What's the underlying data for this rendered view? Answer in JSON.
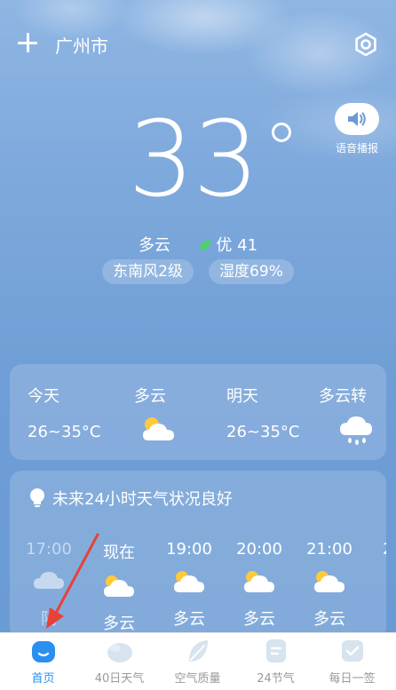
{
  "header": {
    "city": "广州市"
  },
  "voice": {
    "label": "语音播报"
  },
  "current": {
    "temperature": "33",
    "condition": "多云",
    "aqi": "优 41",
    "wind": "东南风2级",
    "humidity": "湿度69%"
  },
  "daily": [
    {
      "day": "今天",
      "condition": "多云",
      "range": "26~35°C",
      "icon": "cloudy-sun-icon"
    },
    {
      "day": "明天",
      "condition": "多云转",
      "range": "26~35°C",
      "icon": "rain-cloud-icon"
    }
  ],
  "hourly": {
    "tip": "未来24小时天气状况良好",
    "items": [
      {
        "time": "17:00",
        "condition": "阴",
        "past": true,
        "icon": "overcast-icon"
      },
      {
        "time": "现在",
        "condition": "多云",
        "past": false,
        "icon": "cloudy-sun-icon"
      },
      {
        "time": "19:00",
        "condition": "多云",
        "past": false,
        "icon": "cloudy-sun-icon"
      },
      {
        "time": "20:00",
        "condition": "多云",
        "past": false,
        "icon": "cloudy-sun-icon"
      },
      {
        "time": "21:00",
        "condition": "多云",
        "past": false,
        "icon": "cloudy-sun-icon"
      },
      {
        "time": "2",
        "condition": "",
        "past": false,
        "icon": ""
      }
    ]
  },
  "nav": [
    {
      "label": "首页",
      "icon": "home-icon",
      "active": true
    },
    {
      "label": "40日天气",
      "icon": "forty-day-icon",
      "active": false
    },
    {
      "label": "空气质量",
      "icon": "leaf-icon",
      "active": false
    },
    {
      "label": "24节气",
      "icon": "solar-term-icon",
      "active": false
    },
    {
      "label": "每日一签",
      "icon": "daily-sign-icon",
      "active": false
    }
  ],
  "colors": {
    "accent": "#2b8ff0",
    "leaf": "#4cd26e",
    "arrow": "#e8413a"
  }
}
